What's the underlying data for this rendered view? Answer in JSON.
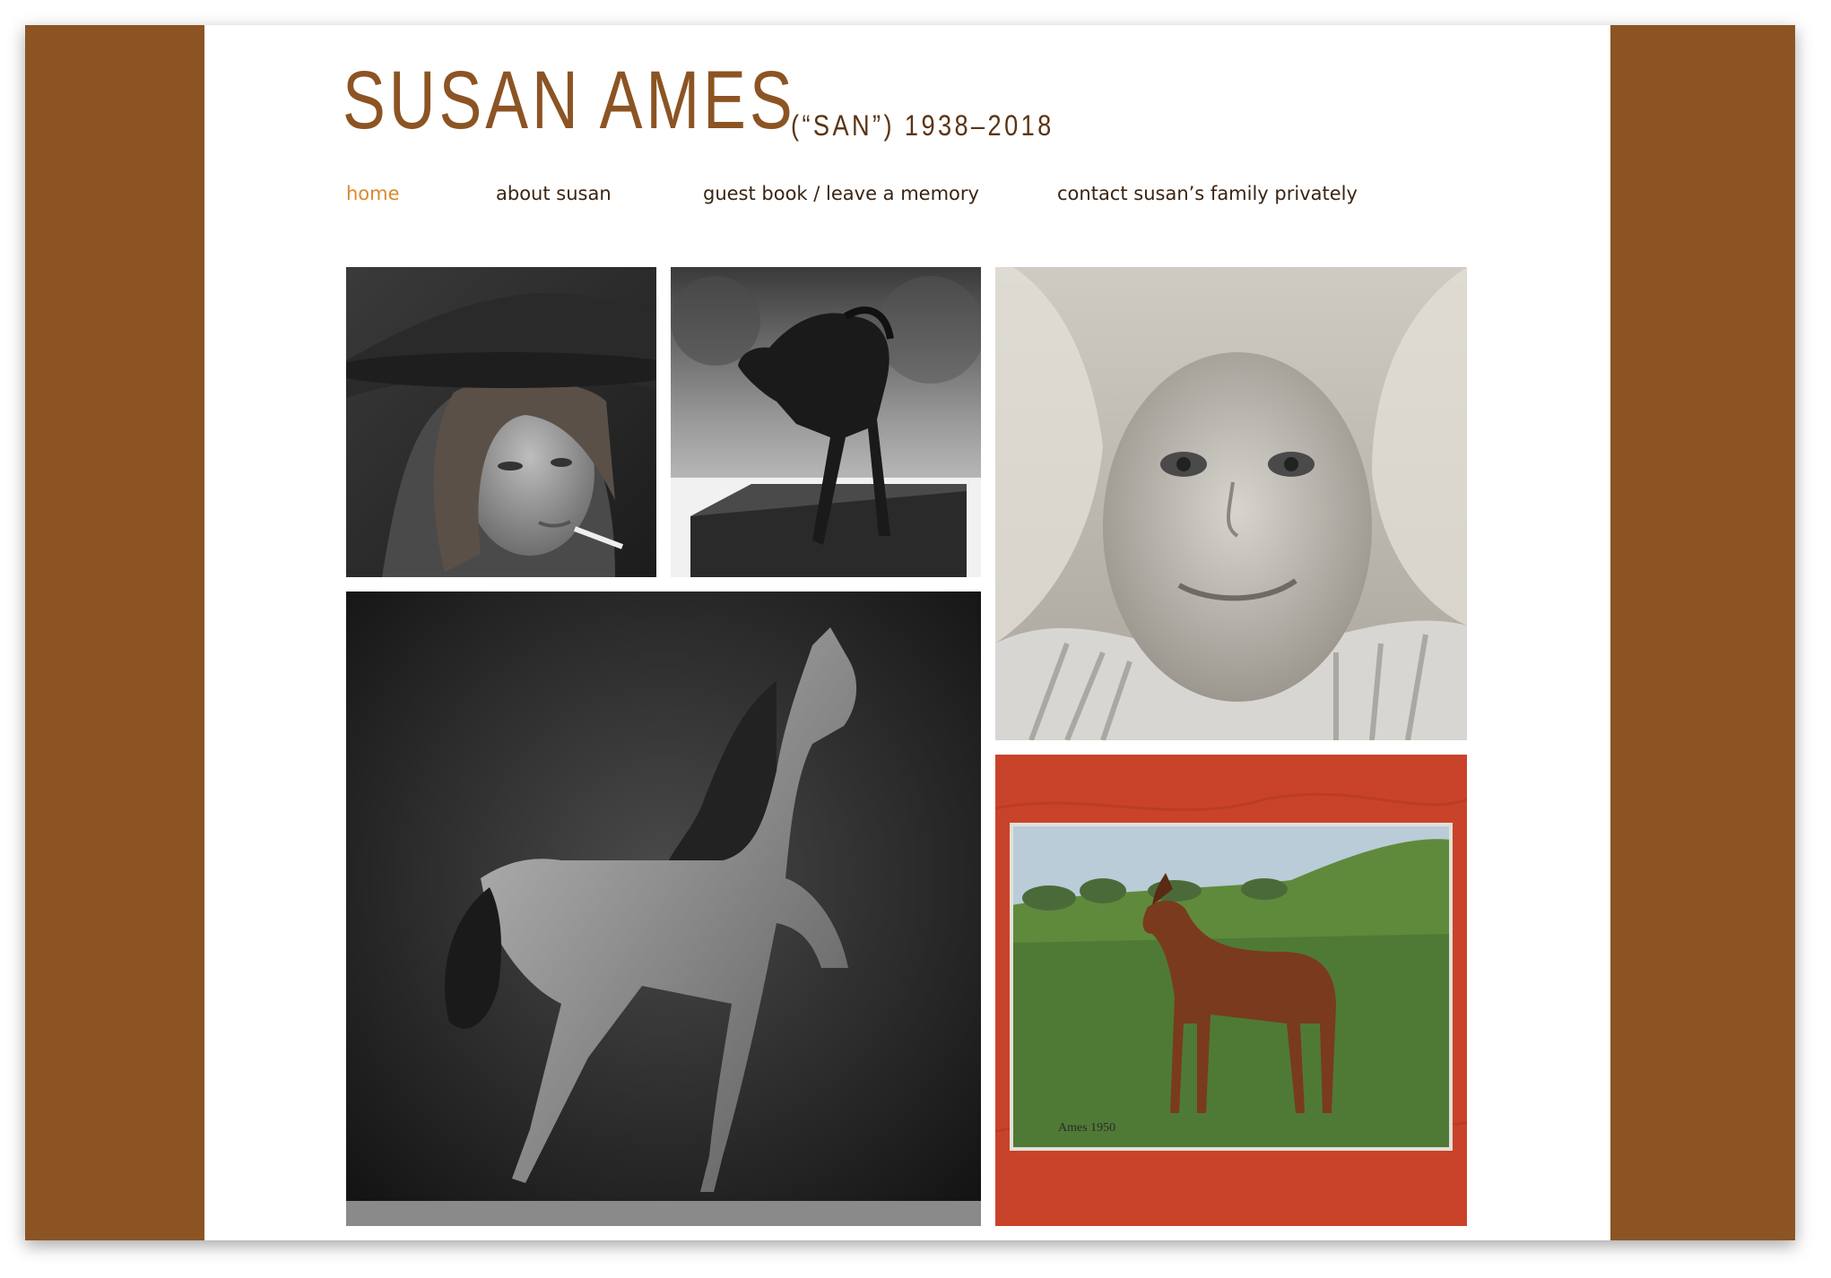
{
  "site": {
    "title": "SUSAN AMES",
    "subtitle": "(“SAN”) 1938–2018"
  },
  "nav": {
    "items": [
      {
        "label": "home",
        "active": true
      },
      {
        "label": "about susan",
        "active": false
      },
      {
        "label": "guest book / leave a memory",
        "active": false
      },
      {
        "label": "contact susan’s family privately",
        "active": false
      }
    ]
  },
  "gallery": {
    "photos": [
      {
        "subject": "portrait of young woman in cowboy hat with cigarette",
        "tone": "black-and-white"
      },
      {
        "subject": "bronze foal sculpture on wooden base",
        "tone": "black-and-white"
      },
      {
        "subject": "smiling blonde girl portrait",
        "tone": "black-and-white"
      },
      {
        "subject": "bronze horse sculpture with raised foreleg",
        "tone": "black-and-white"
      },
      {
        "subject": "oil painting of chestnut horse in field on red background",
        "tone": "color",
        "signature": "Ames 1950"
      }
    ]
  },
  "colors": {
    "brand_brown": "#8c5423",
    "nav_active": "#d98a2e",
    "nav_text": "#3a2413",
    "painting_background": "#c9432a"
  }
}
